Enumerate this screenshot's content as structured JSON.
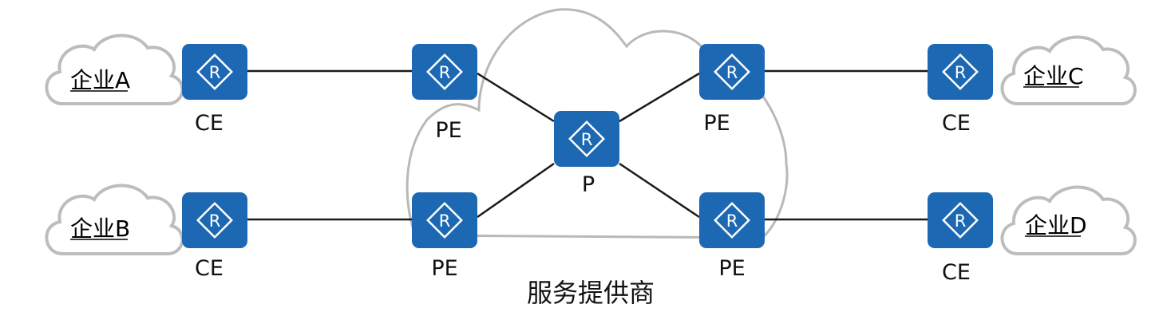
{
  "provider": {
    "label": "服务提供商"
  },
  "enterprises": {
    "a": {
      "label": "企业A"
    },
    "b": {
      "label": "企业B"
    },
    "c": {
      "label": "企业C"
    },
    "d": {
      "label": "企业D"
    }
  },
  "routers": {
    "router_symbol": "R",
    "ce_a": {
      "label": "CE"
    },
    "ce_b": {
      "label": "CE"
    },
    "ce_c": {
      "label": "CE"
    },
    "ce_d": {
      "label": "CE"
    },
    "pe_top_left": {
      "label": "PE"
    },
    "pe_bottom_left": {
      "label": "PE"
    },
    "pe_top_right": {
      "label": "PE"
    },
    "pe_bottom_right": {
      "label": "PE"
    },
    "p_core": {
      "label": "P"
    }
  },
  "colors": {
    "router_fill": "#1d68b2",
    "cloud_stroke": "#bdbdbd",
    "link": "#1a1a1a"
  },
  "icons": {
    "router": "router-icon",
    "cloud": "cloud-icon"
  }
}
